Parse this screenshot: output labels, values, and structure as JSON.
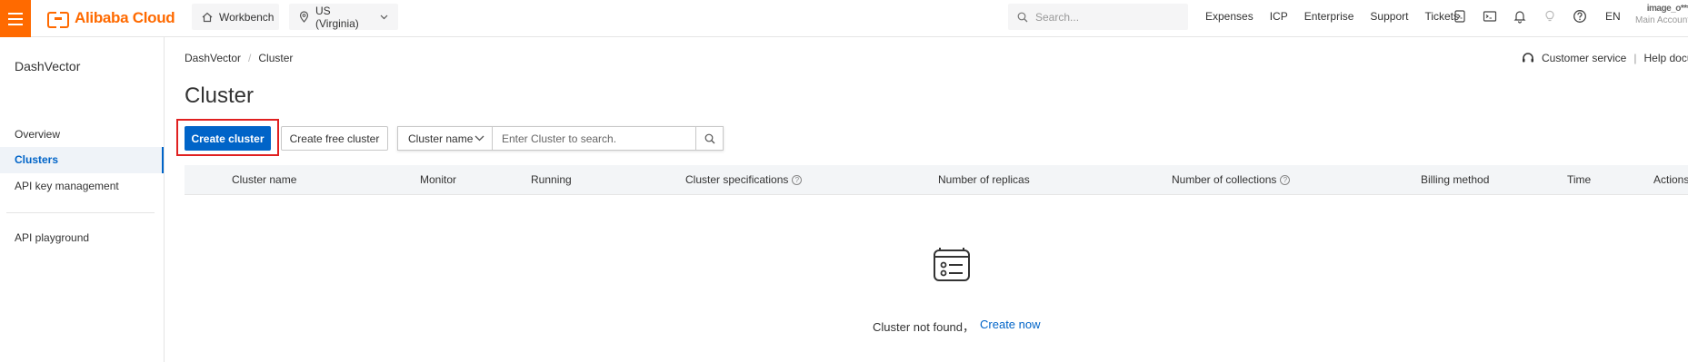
{
  "topbar": {
    "brand": "Alibaba Cloud",
    "workbench": "Workbench",
    "region": "US (Virginia)",
    "search_placeholder": "Search...",
    "links": [
      "Expenses",
      "ICP",
      "Enterprise",
      "Support",
      "Tickets"
    ],
    "lang": "EN",
    "account_name": "image_o***",
    "account_sub": "Main Account"
  },
  "sidebar": {
    "title": "DashVector",
    "items": [
      {
        "label": "Overview"
      },
      {
        "label": "Clusters"
      },
      {
        "label": "API key management"
      },
      {
        "label": "API playground"
      }
    ]
  },
  "breadcrumb": [
    "DashVector",
    "/",
    "Cluster"
  ],
  "header_links": {
    "customer_service": "Customer service",
    "separator": "|",
    "help_docs": "Help docume"
  },
  "main": {
    "title": "Cluster",
    "create_button": "Create cluster",
    "create_free_button": "Create free cluster",
    "search_field_select": "Cluster name",
    "search_placeholder": "Enter Cluster to search."
  },
  "table": {
    "columns": [
      "Cluster name",
      "Monitor",
      "Running",
      "Cluster specifications",
      "Number of replicas",
      "Number of collections",
      "Billing method",
      "Time",
      "Actions"
    ]
  },
  "empty_state": {
    "message": "Cluster not found，",
    "action": "Create now"
  },
  "colors": {
    "accent_orange": "#ff6a00",
    "primary_blue": "#0064c8",
    "highlight_red": "#e02020"
  }
}
